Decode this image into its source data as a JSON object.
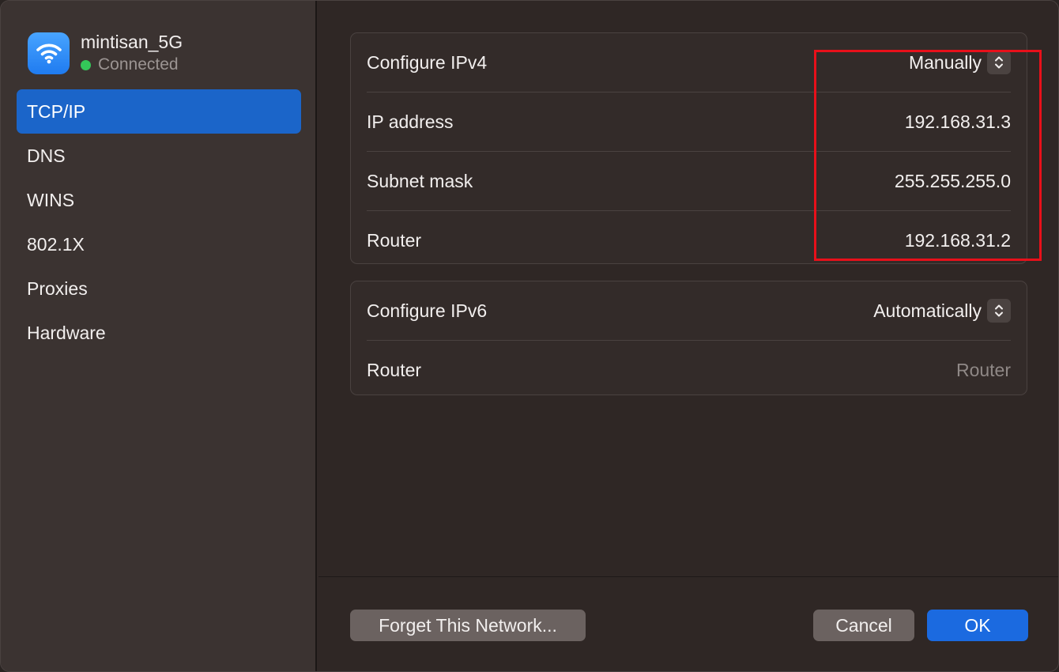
{
  "network": {
    "name": "mintisan_5G",
    "status": "Connected",
    "status_color": "#34c759",
    "icon": "wifi-icon"
  },
  "sidebar": {
    "items": [
      {
        "label": "TCP/IP",
        "active": true
      },
      {
        "label": "DNS"
      },
      {
        "label": "WINS"
      },
      {
        "label": "802.1X"
      },
      {
        "label": "Proxies"
      },
      {
        "label": "Hardware"
      }
    ]
  },
  "ipv4": {
    "configure_label": "Configure IPv4",
    "configure_value": "Manually",
    "ip_label": "IP address",
    "ip_value": "192.168.31.3",
    "subnet_label": "Subnet mask",
    "subnet_value": "255.255.255.0",
    "router_label": "Router",
    "router_value": "192.168.31.2"
  },
  "ipv6": {
    "configure_label": "Configure IPv6",
    "configure_value": "Automatically",
    "router_label": "Router",
    "router_placeholder": "Router"
  },
  "buttons": {
    "forget": "Forget This Network...",
    "cancel": "Cancel",
    "ok": "OK"
  },
  "colors": {
    "accent": "#1b6ae0",
    "highlight_box": "#e8101a"
  }
}
